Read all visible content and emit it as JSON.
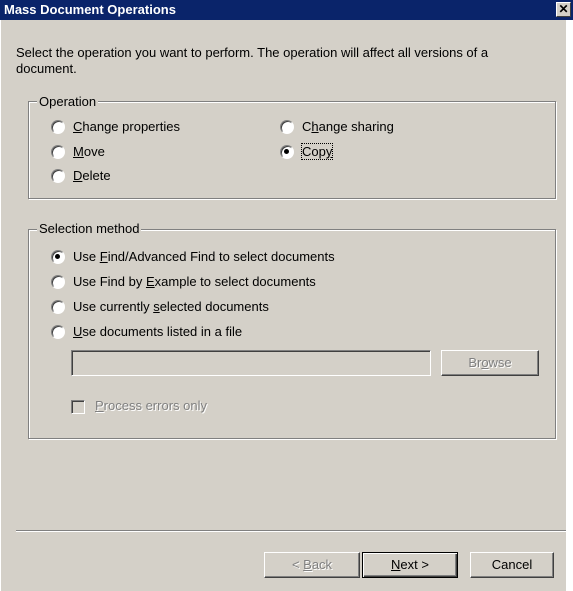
{
  "window": {
    "title": "Mass Document Operations",
    "close_glyph": "✕"
  },
  "instructions": "Select the operation you want to perform. The operation will affect all versions of a document.",
  "operation": {
    "legend": "Operation",
    "options": [
      {
        "label_pre": "",
        "label_u": "C",
        "label_post": "hange properties",
        "selected": false
      },
      {
        "label_pre": "",
        "label_u": "M",
        "label_post": "ove",
        "selected": false
      },
      {
        "label_pre": "",
        "label_u": "D",
        "label_post": "elete",
        "selected": false
      },
      {
        "label_pre": "C",
        "label_u": "h",
        "label_post": "ange sharing",
        "selected": false
      },
      {
        "label_pre": "Cop",
        "label_u": "y",
        "label_post": "",
        "selected": true
      }
    ]
  },
  "selection": {
    "legend": "Selection method",
    "options": [
      {
        "label_pre": "Use ",
        "label_u": "F",
        "label_post": "ind/Advanced Find to select documents",
        "selected": true
      },
      {
        "label_pre": "Use Find by ",
        "label_u": "E",
        "label_post": "xample to select documents",
        "selected": false
      },
      {
        "label_pre": "Use currently ",
        "label_u": "s",
        "label_post": "elected documents",
        "selected": false
      },
      {
        "label_pre": "",
        "label_u": "U",
        "label_post": "se documents listed in a file",
        "selected": false
      }
    ],
    "file_input_value": "",
    "browse": {
      "pre": "Br",
      "u": "o",
      "post": "wse"
    },
    "process_errors": {
      "pre": "",
      "u": "P",
      "post": "rocess errors only",
      "checked": false
    }
  },
  "buttons": {
    "back": {
      "pre": "< ",
      "u": "B",
      "post": "ack"
    },
    "next": {
      "pre": "",
      "u": "N",
      "post": "ext >"
    },
    "cancel": "Cancel"
  }
}
